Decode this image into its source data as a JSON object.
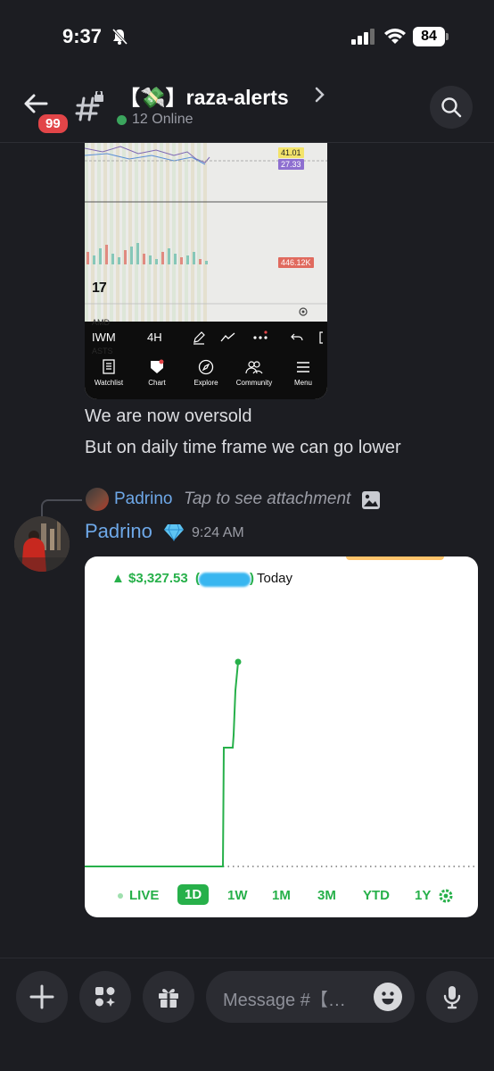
{
  "status_bar": {
    "time": "9:37",
    "battery": "84"
  },
  "header": {
    "unread_count": "99",
    "channel_name": "【💸】raza-alerts",
    "online": "12 Online"
  },
  "tv_screenshot": {
    "price_labels": [
      "41.01",
      "27.33"
    ],
    "volume_label": "446.12K",
    "logo": "17",
    "hidden_tickers": [
      "AMD",
      "ASTS"
    ],
    "toolbar": {
      "symbol": "IWM",
      "interval": "4H"
    },
    "tabs": [
      "Watchlist",
      "Chart",
      "Explore",
      "Community",
      "Menu"
    ]
  },
  "messages": {
    "line1": "We are now oversold",
    "line2": "But on daily time frame we can go lower"
  },
  "reply": {
    "author": "Padrino",
    "preview": "Tap to see attachment"
  },
  "post": {
    "author": "Padrino",
    "badge_icon": "gem-icon",
    "timestamp": "9:24 AM"
  },
  "robinhood_card": {
    "change": "▲ $3,327.53",
    "period": "Today",
    "ranges": [
      "LIVE",
      "1D",
      "1W",
      "1M",
      "3M",
      "YTD",
      "1Y"
    ],
    "active_range": "1D",
    "accent_color": "#27b04a"
  },
  "composer": {
    "placeholder": "Message #【…"
  }
}
